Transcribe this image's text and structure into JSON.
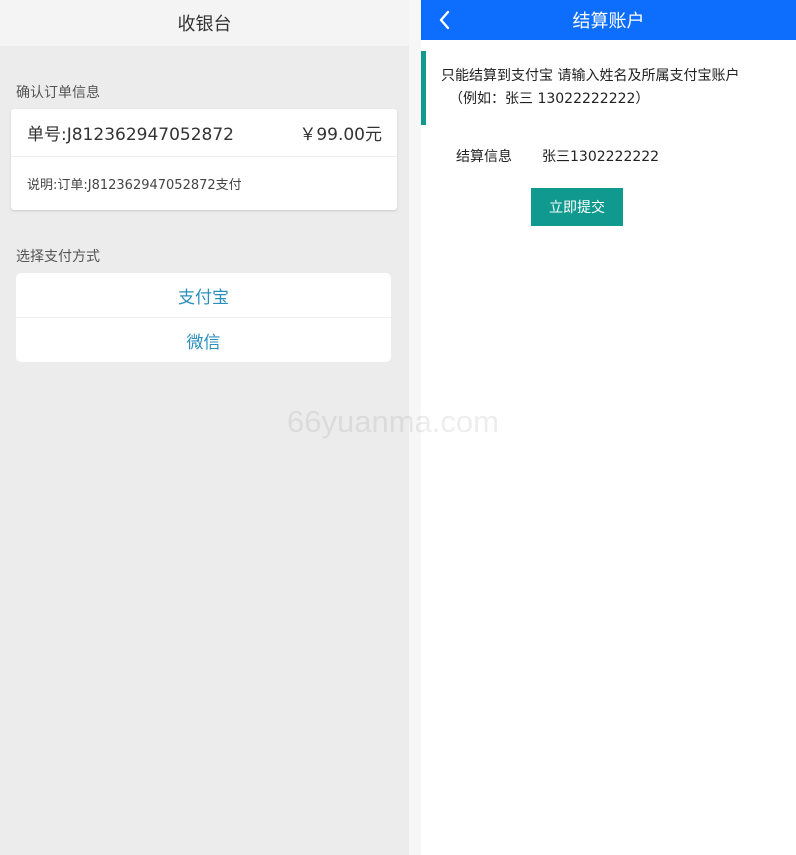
{
  "left": {
    "header_title": "收银台",
    "order_section_label": "确认订单信息",
    "order": {
      "number": "单号:J812362947052872",
      "amount": "￥99.00元",
      "description": "说明:订单:J812362947052872支付"
    },
    "payment_section_label": "选择支付方式",
    "payment_methods": [
      "支付宝",
      "微信"
    ]
  },
  "right": {
    "header_title": "结算账户",
    "notice_line1": "只能结算到支付宝 请输入姓名及所属支付宝账户",
    "notice_line2": "（例如：张三 13022222222）",
    "settle_label": "结算信息",
    "settle_value": "张三1302222222",
    "submit_label": "立即提交"
  },
  "watermark": "66yuanma.com",
  "colors": {
    "header_blue": "#0d6efd",
    "accent_teal": "#109a8f",
    "link_blue": "#2a8fbd"
  }
}
